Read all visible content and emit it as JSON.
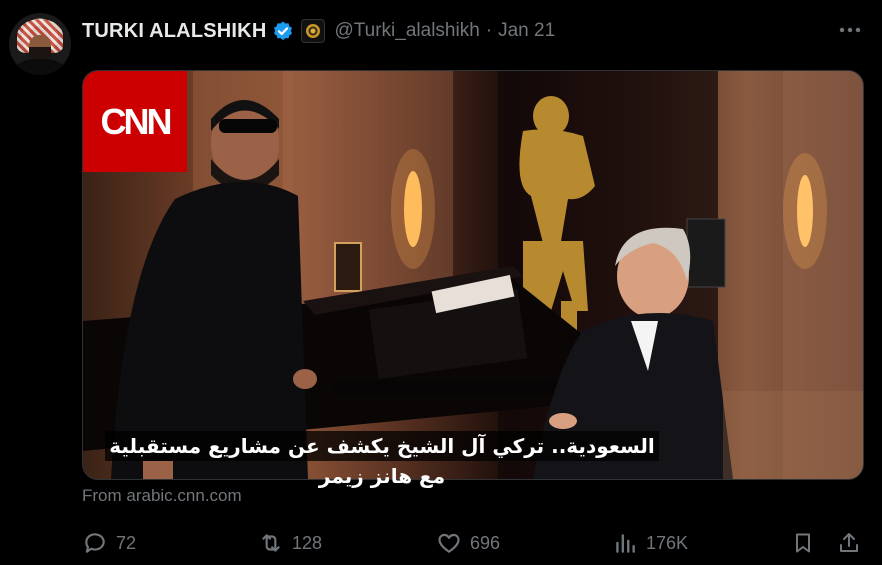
{
  "tweet": {
    "author_name": "TURKI ALALSHIKH",
    "handle": "@Turki_alalshikh",
    "separator": "·",
    "date": "Jan 21",
    "verified_color": "#1d9bf0"
  },
  "media": {
    "logo_text": "CNN",
    "caption": "السعودية.. تركي آل الشيخ يكشف عن مشاريع مستقبلية مع هانز زيمر",
    "source": "From arabic.cnn.com"
  },
  "actions": {
    "replies": "72",
    "reposts": "128",
    "likes": "696",
    "views": "176K"
  },
  "colors": {
    "background": "#000000",
    "muted_text": "#71767b",
    "primary_text": "#e7e9ea",
    "cnn_red": "#cc0000"
  }
}
